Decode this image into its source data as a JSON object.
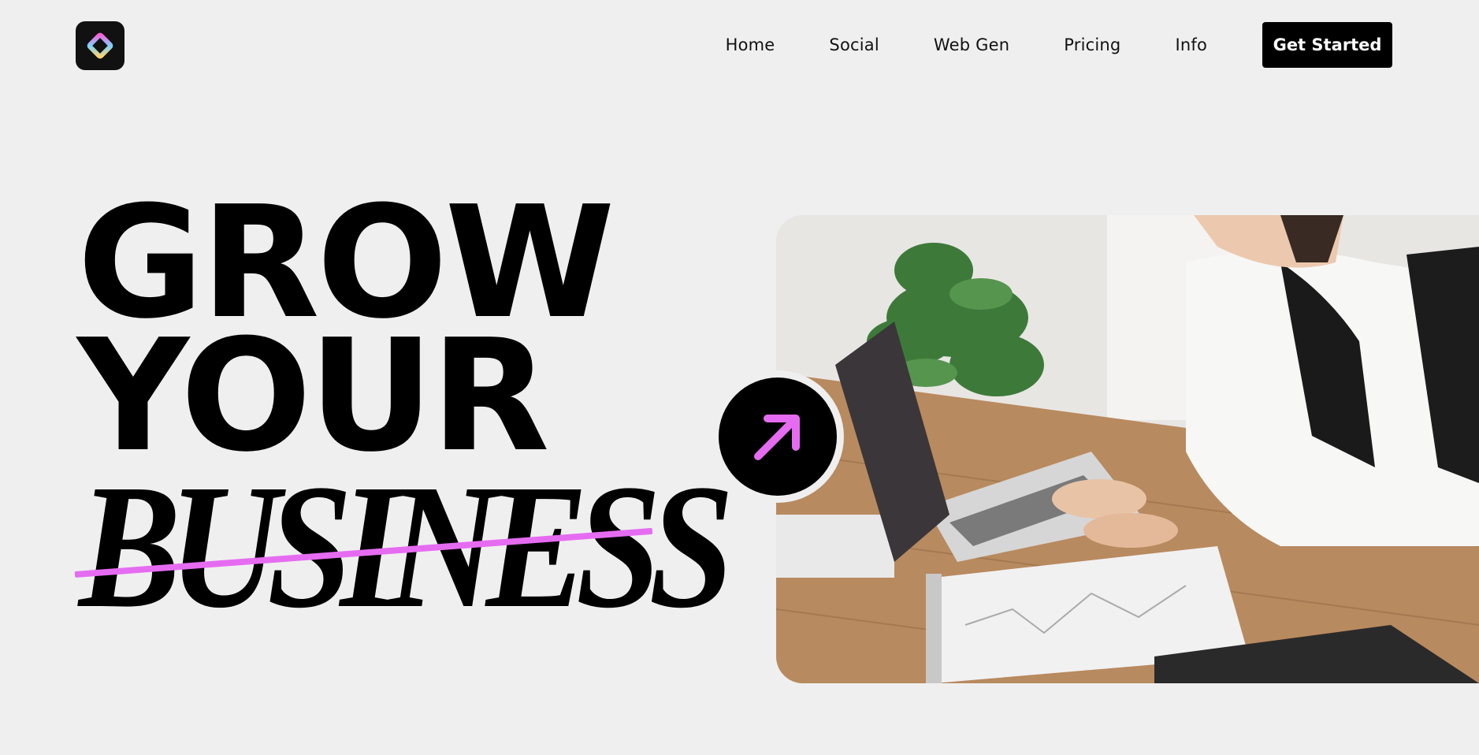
{
  "header": {
    "logo_icon": "diamond-logo-icon",
    "nav": [
      "Home",
      "Social",
      "Web Gen",
      "Pricing",
      "Info"
    ],
    "cta_label": "Get Started"
  },
  "hero": {
    "line1": "GROW",
    "line2": "YOUR",
    "line3": "BUSINESS",
    "accent_color": "#e56cf1",
    "image": "woman-typing-on-laptop-photo",
    "arrow_icon": "arrow-up-right-icon"
  }
}
